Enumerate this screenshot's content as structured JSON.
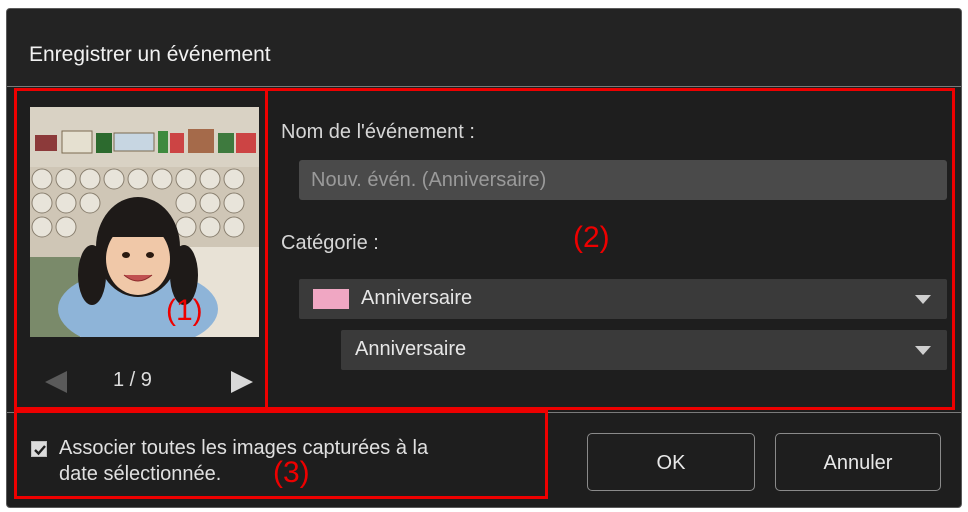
{
  "dialog": {
    "title": "Enregistrer un événement"
  },
  "preview": {
    "page_counter": "1 / 9",
    "prev_icon": "triangle-left-icon",
    "next_icon": "triangle-right-icon"
  },
  "form": {
    "name_label": "Nom de l'événement :",
    "name_value": "Nouv. évén. (Anniversaire)",
    "category_label": "Catégorie :",
    "category_select": "Anniversaire",
    "category_color": "#f0a7c3",
    "subcategory_select": "Anniversaire"
  },
  "footer": {
    "associate_checkbox_checked": true,
    "associate_label_line1": "Associer toutes les images capturées à la",
    "associate_label_line2": "date sélectionnée.",
    "ok_label": "OK",
    "cancel_label": "Annuler"
  },
  "annotations": {
    "marker1": "(1)",
    "marker2": "(2)",
    "marker3": "(3)",
    "color": "#ee0000"
  }
}
